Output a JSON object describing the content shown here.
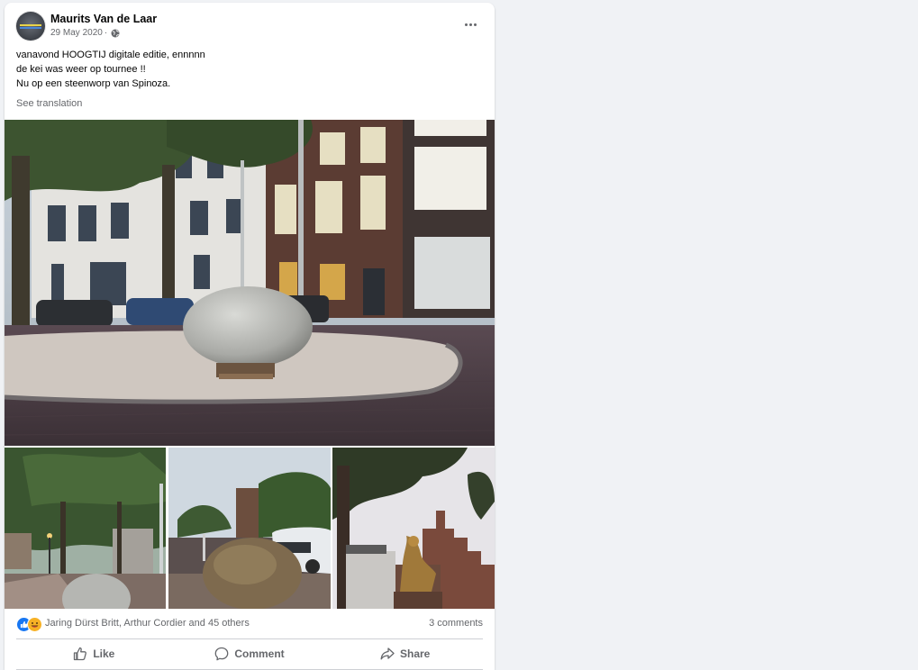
{
  "post": {
    "author": "Maurits Van de Laar",
    "date": "29 May 2020",
    "separator": "·",
    "text_lines": [
      "vanavond HOOGTIJ digitale editie, ennnnn",
      "de kei was weer op tournee !!",
      "Nu op een steenworp van Spinoza."
    ],
    "see_translation": "See translation"
  },
  "reactions": {
    "names": "Jaring Dürst Britt, Arthur Cordier and 45 others",
    "comments": "3 comments"
  },
  "actions": {
    "like": "Like",
    "comment": "Comment",
    "share": "Share"
  },
  "icons": {
    "privacy": "globe-icon",
    "more": "more-options-icon",
    "like": "thumbs-up-icon",
    "comment": "speech-bubble-icon",
    "share": "share-arrow-icon"
  },
  "colors": {
    "background": "#f0f2f5",
    "card": "#ffffff",
    "secondary_text": "#65676b",
    "like_blue": "#1877f2",
    "haha_yellow": "#f7b125"
  }
}
